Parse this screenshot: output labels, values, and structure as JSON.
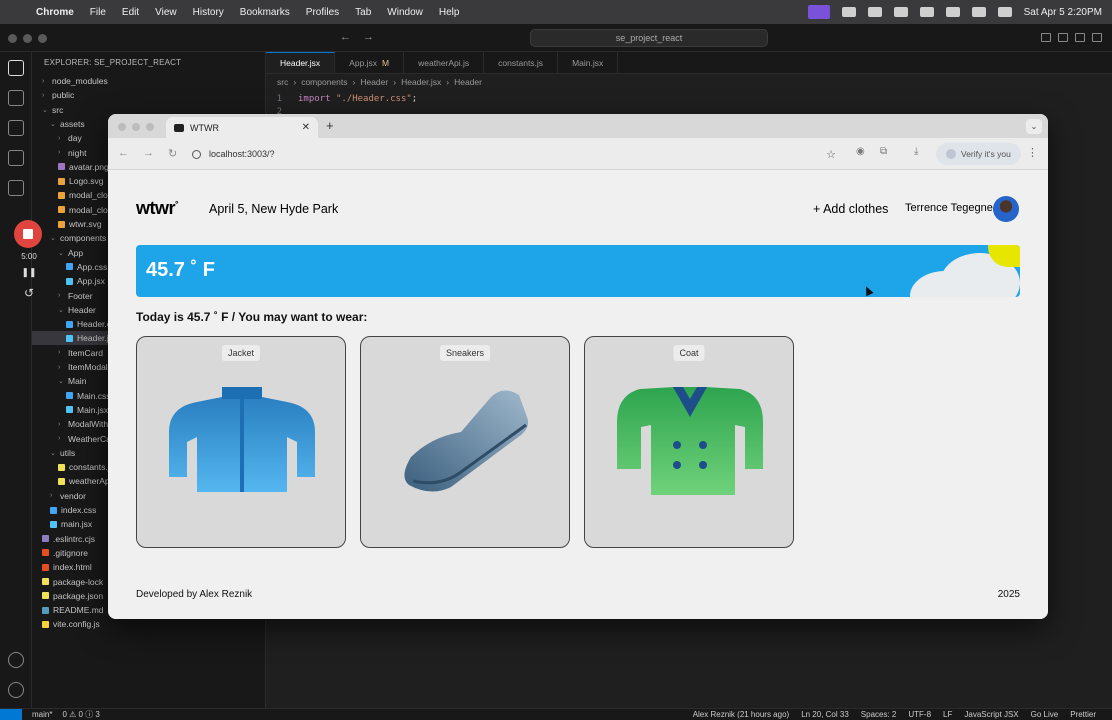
{
  "menubar": {
    "app": "Chrome",
    "items": [
      "File",
      "Edit",
      "View",
      "History",
      "Bookmarks",
      "Profiles",
      "Tab",
      "Window",
      "Help"
    ],
    "clock": "Sat Apr 5  2:20PM"
  },
  "vscode": {
    "command_center": "se_project_react",
    "explorer_title": "EXPLORER: SE_PROJECT_REACT",
    "tree": [
      {
        "label": "node_modules",
        "indent": 0,
        "kind": "folder",
        "open": false
      },
      {
        "label": "public",
        "indent": 0,
        "kind": "folder",
        "open": false
      },
      {
        "label": "src",
        "indent": 0,
        "kind": "folder",
        "open": true
      },
      {
        "label": "assets",
        "indent": 1,
        "kind": "folder",
        "open": true
      },
      {
        "label": "day",
        "indent": 2,
        "kind": "folder",
        "open": false
      },
      {
        "label": "night",
        "indent": 2,
        "kind": "folder",
        "open": false
      },
      {
        "label": "avatar.png",
        "indent": 2,
        "kind": "img"
      },
      {
        "label": "Logo.svg",
        "indent": 2,
        "kind": "svg"
      },
      {
        "label": "modal_clos",
        "indent": 2,
        "kind": "svg"
      },
      {
        "label": "modal_clos",
        "indent": 2,
        "kind": "svg"
      },
      {
        "label": "wtwr.svg",
        "indent": 2,
        "kind": "svg"
      },
      {
        "label": "components",
        "indent": 1,
        "kind": "folder",
        "open": true
      },
      {
        "label": "App",
        "indent": 2,
        "kind": "folder",
        "open": true
      },
      {
        "label": "App.css",
        "indent": 3,
        "kind": "css"
      },
      {
        "label": "App.jsx",
        "indent": 3,
        "kind": "jsx"
      },
      {
        "label": "Footer",
        "indent": 2,
        "kind": "folder",
        "open": false
      },
      {
        "label": "Header",
        "indent": 2,
        "kind": "folder",
        "open": true
      },
      {
        "label": "Header.cs",
        "indent": 3,
        "kind": "css"
      },
      {
        "label": "Header.js",
        "indent": 3,
        "kind": "jsx",
        "selected": true
      },
      {
        "label": "ItemCard",
        "indent": 2,
        "kind": "folder",
        "open": false
      },
      {
        "label": "ItemModal",
        "indent": 2,
        "kind": "folder",
        "open": false
      },
      {
        "label": "Main",
        "indent": 2,
        "kind": "folder",
        "open": true
      },
      {
        "label": "Main.css",
        "indent": 3,
        "kind": "css"
      },
      {
        "label": "Main.jsx",
        "indent": 3,
        "kind": "jsx"
      },
      {
        "label": "ModalWith",
        "indent": 2,
        "kind": "folder",
        "open": false
      },
      {
        "label": "WeatherCa",
        "indent": 2,
        "kind": "folder",
        "open": false
      },
      {
        "label": "utils",
        "indent": 1,
        "kind": "folder",
        "open": true
      },
      {
        "label": "constants.j",
        "indent": 2,
        "kind": "js"
      },
      {
        "label": "weatherApi",
        "indent": 2,
        "kind": "js"
      },
      {
        "label": "vendor",
        "indent": 1,
        "kind": "folder",
        "open": false
      },
      {
        "label": "index.css",
        "indent": 1,
        "kind": "css"
      },
      {
        "label": "main.jsx",
        "indent": 1,
        "kind": "jsx"
      },
      {
        "label": ".eslintrc.cjs",
        "indent": 0,
        "kind": "eslint"
      },
      {
        "label": ".gitignore",
        "indent": 0,
        "kind": "git"
      },
      {
        "label": "index.html",
        "indent": 0,
        "kind": "html"
      },
      {
        "label": "package-lock",
        "indent": 0,
        "kind": "json"
      },
      {
        "label": "package.json",
        "indent": 0,
        "kind": "json"
      },
      {
        "label": "README.md",
        "indent": 0,
        "kind": "md"
      },
      {
        "label": "vite.config.js",
        "indent": 0,
        "kind": "vite"
      }
    ],
    "tabs": [
      {
        "label": "Header.jsx",
        "active": true,
        "badge": ""
      },
      {
        "label": "App.jsx",
        "active": false,
        "badge": "M"
      },
      {
        "label": "weatherApi.js",
        "active": false,
        "badge": ""
      },
      {
        "label": "constants.js",
        "active": false,
        "badge": ""
      },
      {
        "label": "Main.jsx",
        "active": false,
        "badge": ""
      }
    ],
    "breadcrumb": [
      "src",
      "components",
      "Header",
      "Header.jsx",
      "Header"
    ],
    "code": [
      {
        "line": "1",
        "keyword": "import",
        "string": "\"./Header.css\"",
        "tail": ";"
      },
      {
        "line": "2",
        "keyword": "",
        "string": "",
        "tail": ""
      }
    ],
    "status": {
      "branch": "main*",
      "problems": "0 ⚠ 0 ⓘ 3",
      "blame": "Alex Reznik (21 hours ago)",
      "position": "Ln 20, Col 33",
      "spaces": "Spaces: 2",
      "encoding": "UTF-8",
      "eol": "LF",
      "language": "JavaScript JSX",
      "golive": "Go Live",
      "prettier": "Prettier"
    }
  },
  "recorder": {
    "time": "5:00"
  },
  "chrome": {
    "tab_title": "WTWR",
    "url": "localhost:3003/?",
    "verify": "Verify it's you"
  },
  "app": {
    "logo": "wtwr",
    "logo_mark": "°",
    "date_location": "April 5, New Hyde Park",
    "add_clothes": "+ Add clothes",
    "username": "Terrence Tegegne",
    "temperature": "45.7 ˚ F",
    "wear_text": "Today is 45.7 ˚ F / You may want to wear:",
    "items": [
      {
        "name": "Jacket",
        "icon": "jacket-icon"
      },
      {
        "name": "Sneakers",
        "icon": "sneaker-icon"
      },
      {
        "name": "Coat",
        "icon": "coat-icon"
      }
    ],
    "footer_dev": "Developed by Alex Reznik",
    "footer_year": "2025",
    "colors": {
      "weather": "#1ea5e9",
      "jacket": "#3b9bd8",
      "coat": "#3fb558"
    }
  }
}
